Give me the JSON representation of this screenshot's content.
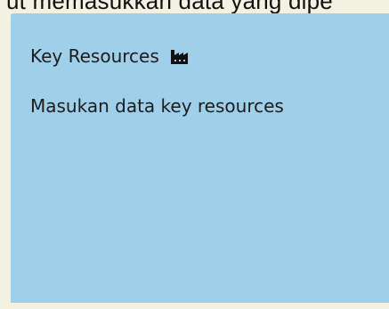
{
  "header": {
    "instruction_text": "ut memasukkan data yang dipe"
  },
  "card": {
    "title": "Key Resources",
    "title_icon": "factory-icon",
    "subtitle": "Masukan data key resources",
    "background_color": "#9fcfe9"
  }
}
